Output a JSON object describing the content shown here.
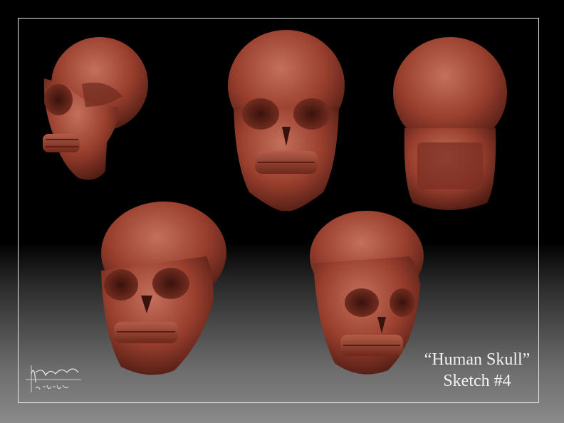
{
  "caption": {
    "title": "“Human Skull”",
    "subtitle": "Sketch #4"
  },
  "signature": {
    "name": "Abrul Torres",
    "date": "5-27-2012"
  },
  "colors": {
    "background_top": "#000000",
    "background_bottom": "#8a8a8a",
    "skull_base": "#9a3f2e",
    "skull_highlight": "#c3705d",
    "skull_shadow": "#4b1a12",
    "frame": "#e6e6e6",
    "caption_text": "#f2f2f2"
  },
  "views": [
    {
      "label": "skull-side-view"
    },
    {
      "label": "skull-front-view"
    },
    {
      "label": "skull-back-view"
    },
    {
      "label": "skull-three-quarter-left-view"
    },
    {
      "label": "skull-three-quarter-right-view"
    }
  ]
}
